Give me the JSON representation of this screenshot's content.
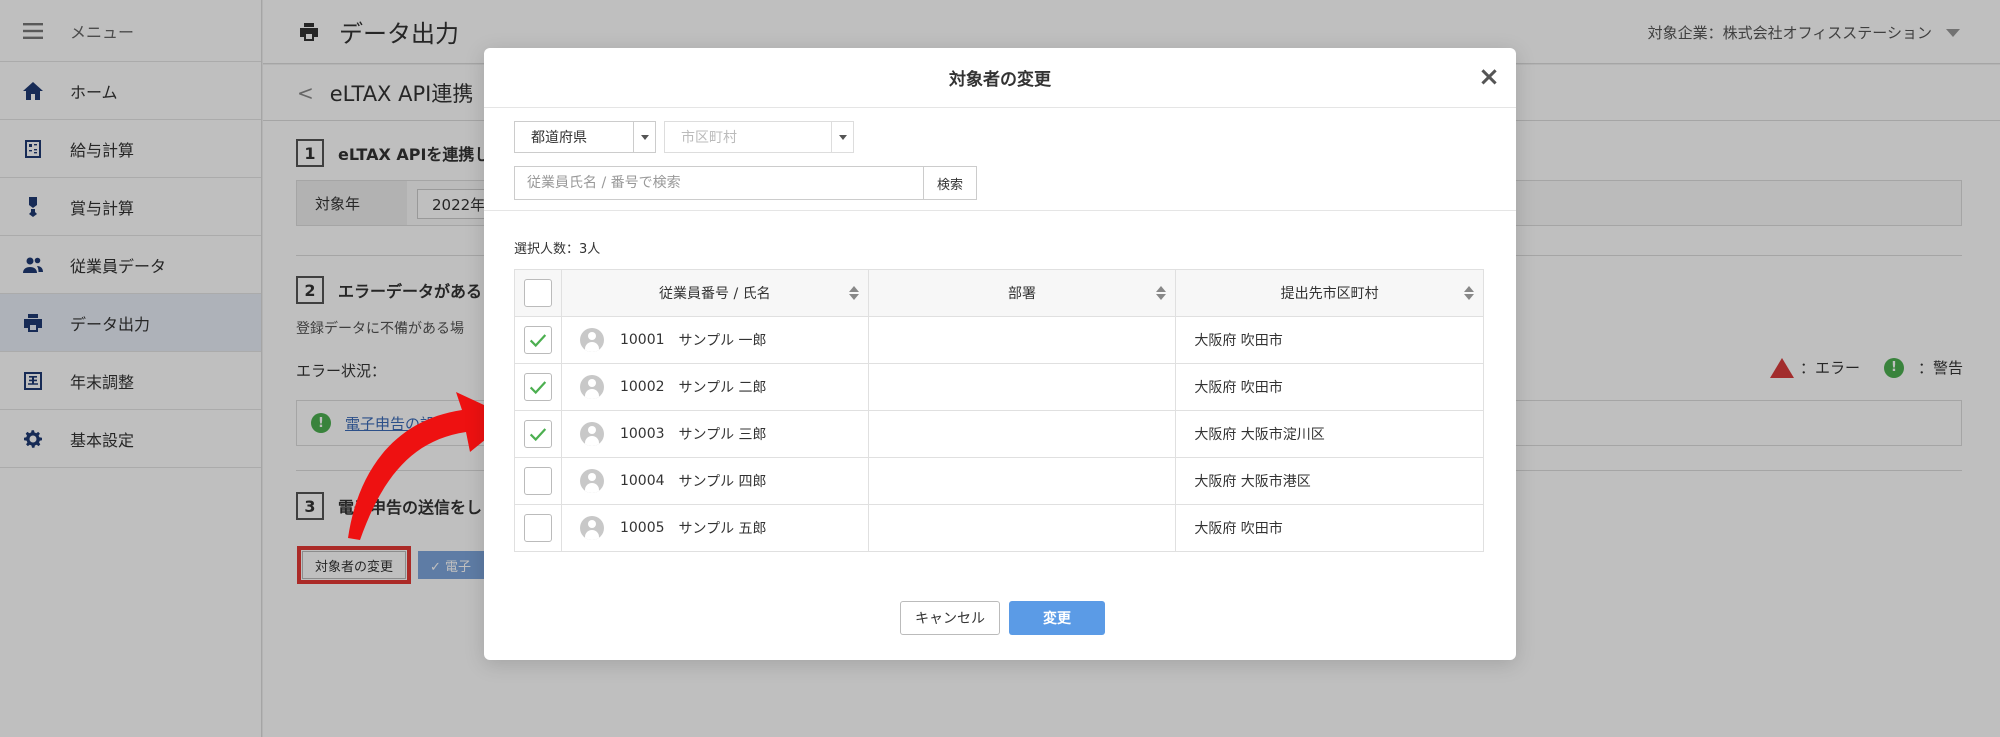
{
  "sidebar": {
    "menu_label": "メニュー",
    "items": [
      {
        "label": "ホーム",
        "icon": "home-icon"
      },
      {
        "label": "給与計算",
        "icon": "calculator-icon"
      },
      {
        "label": "賞与計算",
        "icon": "medal-icon"
      },
      {
        "label": "従業員データ",
        "icon": "people-icon"
      },
      {
        "label": "データ出力",
        "icon": "printer-icon"
      },
      {
        "label": "年末調整",
        "icon": "year-icon"
      },
      {
        "label": "基本設定",
        "icon": "gear-icon"
      }
    ],
    "active_index": 4
  },
  "topbar": {
    "title": "データ出力",
    "company": "対象企業：株式会社オフィスステーション"
  },
  "page": {
    "sub_title": "eLTAX API連携",
    "back_glyph": "<",
    "step1": {
      "num": "1",
      "label": "eLTAX APIを連携し"
    },
    "target_year_label": "対象年",
    "target_year_value": "2022年",
    "step2": {
      "num": "2",
      "label": "エラーデータがある"
    },
    "desc": "登録データに不備がある場",
    "error_status_label": "エラー状況：",
    "error_link": "電子申告の設",
    "legend_error": "：エラー",
    "legend_warn": "：警告",
    "legend_warn_glyph": "!",
    "step3": {
      "num": "3",
      "label": "電子申告の送信をし"
    },
    "btn_target": "対象者の変更",
    "btn_send": "✓ 電子"
  },
  "modal": {
    "title": "対象者の変更",
    "close_glyph": "×",
    "prefecture_select": "都道府県",
    "city_select": "市区町村",
    "search_placeholder": "従業員氏名 / 番号で検索",
    "search_button": "検索",
    "selected_count": "選択人数：3人",
    "columns": [
      "従業員番号 / 氏名",
      "部署",
      "提出先市区町村"
    ],
    "rows": [
      {
        "checked": true,
        "no": "10001",
        "name": "サンプル 一郎",
        "dept": "",
        "city": "大阪府 吹田市"
      },
      {
        "checked": true,
        "no": "10002",
        "name": "サンプル 二郎",
        "dept": "",
        "city": "大阪府 吹田市"
      },
      {
        "checked": true,
        "no": "10003",
        "name": "サンプル 三郎",
        "dept": "",
        "city": "大阪府 大阪市淀川区"
      },
      {
        "checked": false,
        "no": "10004",
        "name": "サンプル 四郎",
        "dept": "",
        "city": "大阪府 大阪市港区"
      },
      {
        "checked": false,
        "no": "10005",
        "name": "サンプル 五郎",
        "dept": "",
        "city": "大阪府 吹田市"
      }
    ],
    "cancel_button": "キャンセル",
    "change_button": "変更"
  },
  "colors": {
    "accent": "#5b9be6",
    "check_green": "#4caf50",
    "highlight_red": "#e53935",
    "nav_icon": "#1f3a73"
  }
}
